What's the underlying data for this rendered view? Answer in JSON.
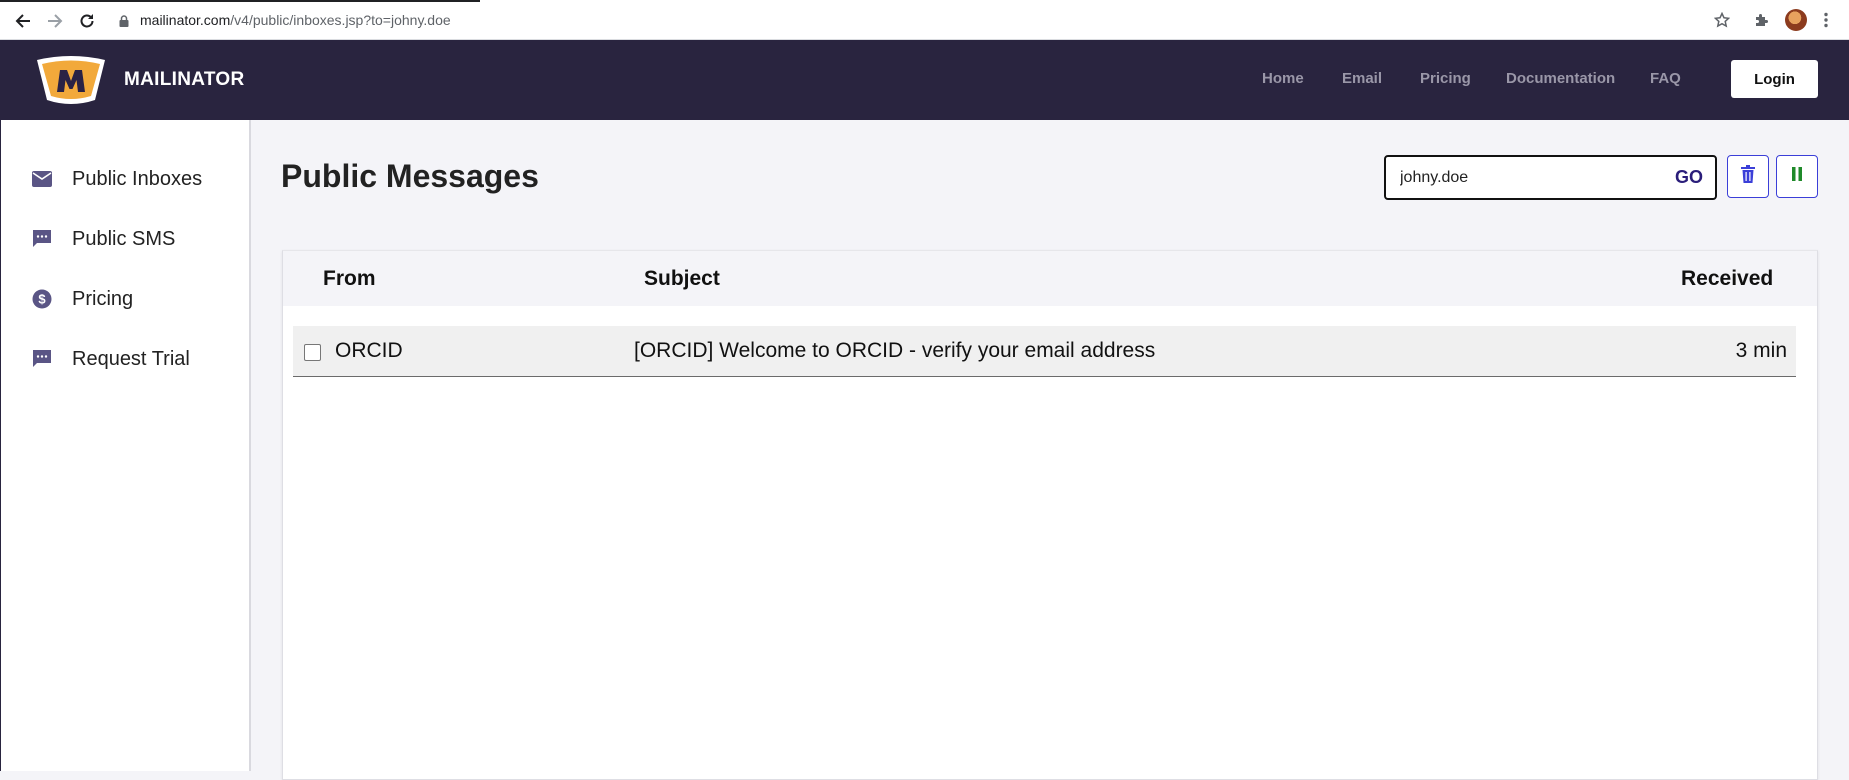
{
  "browser": {
    "url_host": "mailinator.com",
    "url_path": "/v4/public/inboxes.jsp?to=johny.doe"
  },
  "header": {
    "brand": "MAILINATOR",
    "nav": [
      "Home",
      "Email",
      "Pricing",
      "Documentation",
      "FAQ"
    ],
    "login_label": "Login"
  },
  "sidebar": {
    "items": [
      {
        "label": "Public Inboxes",
        "icon": "envelope-icon"
      },
      {
        "label": "Public SMS",
        "icon": "chat-bubble-icon"
      },
      {
        "label": "Pricing",
        "icon": "dollar-coin-icon"
      },
      {
        "label": "Request Trial",
        "icon": "chat-bubble-icon"
      }
    ]
  },
  "main": {
    "title": "Public Messages",
    "search": {
      "value": "johny.doe",
      "go_label": "GO"
    },
    "table": {
      "headers": {
        "from": "From",
        "subject": "Subject",
        "received": "Received"
      },
      "rows": [
        {
          "from": "ORCID",
          "subject": "[ORCID] Welcome to ORCID - verify your email address",
          "received": "3 min"
        }
      ]
    }
  },
  "colors": {
    "header_bg": "#29243f",
    "accent_blue": "#3b3fd8",
    "pause_green": "#1f8a2a",
    "logo_orange": "#f2a93b"
  }
}
